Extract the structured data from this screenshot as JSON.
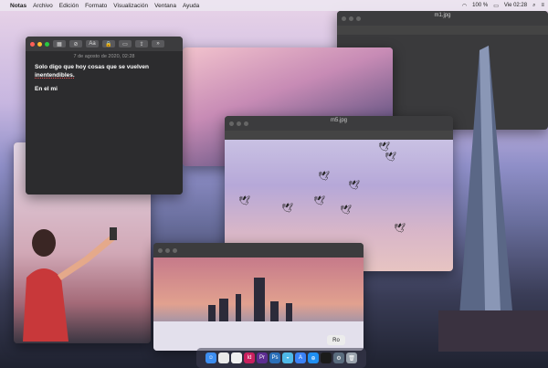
{
  "menubar": {
    "app": "Notas",
    "items": [
      "Archivo",
      "Edición",
      "Formato",
      "Visualización",
      "Ventana",
      "Ayuda"
    ],
    "battery": "100 %",
    "clock": "Vie 02:28"
  },
  "windows": {
    "top_right": {
      "title": "m1.jpg"
    },
    "middle": {
      "title": "m5.jpg"
    }
  },
  "notes": {
    "date": "7 de agosto de 2020, 02:28",
    "text_line1": "Solo digo que hoy cosas que se vuelven",
    "text_line2": "inentendibles.",
    "text_line3": "En el mi"
  },
  "toolbar": {
    "aa_label": "Aa"
  },
  "dock": {
    "tooltip": "Ro",
    "icons": [
      "finder-icon",
      "chrome-icon",
      "firefox-icon",
      "indesign-icon",
      "premiere-icon",
      "photoshop-icon",
      "messages-icon",
      "appstore-icon",
      "safari-icon",
      "preview-icon",
      "settings-icon",
      "trash-icon"
    ]
  }
}
